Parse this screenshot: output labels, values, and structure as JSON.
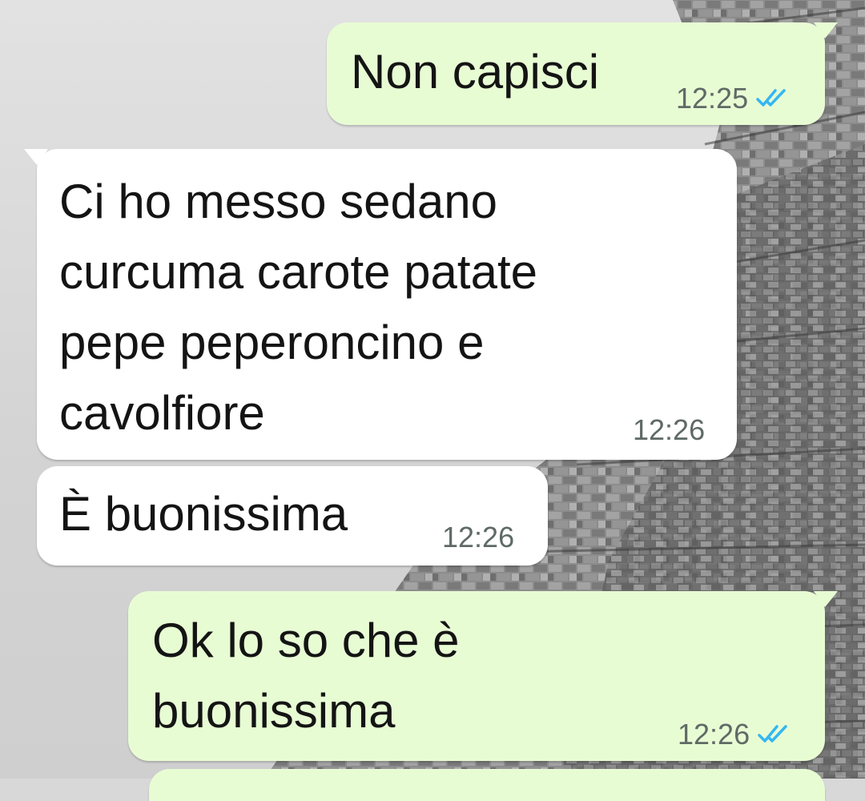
{
  "colors": {
    "outgoing_bubble": "#e8fcd4",
    "incoming_bubble": "#ffffff",
    "read_tick": "#34b7f1",
    "timestamp": "#5f6a66"
  },
  "icons": {
    "read_receipt": "double-check-icon"
  },
  "messages": [
    {
      "direction": "out",
      "text": "Non capisci",
      "time": "12:25",
      "status": "read"
    },
    {
      "direction": "in",
      "text": "Ci ho messo sedano\ncurcuma carote patate\npepe peperoncino e\ncavolfiore",
      "time": "12:26"
    },
    {
      "direction": "in",
      "text": "È buonissima",
      "time": "12:26"
    },
    {
      "direction": "out",
      "text": "Ok lo so che è\nbuonissima",
      "time": "12:26",
      "status": "read"
    }
  ]
}
